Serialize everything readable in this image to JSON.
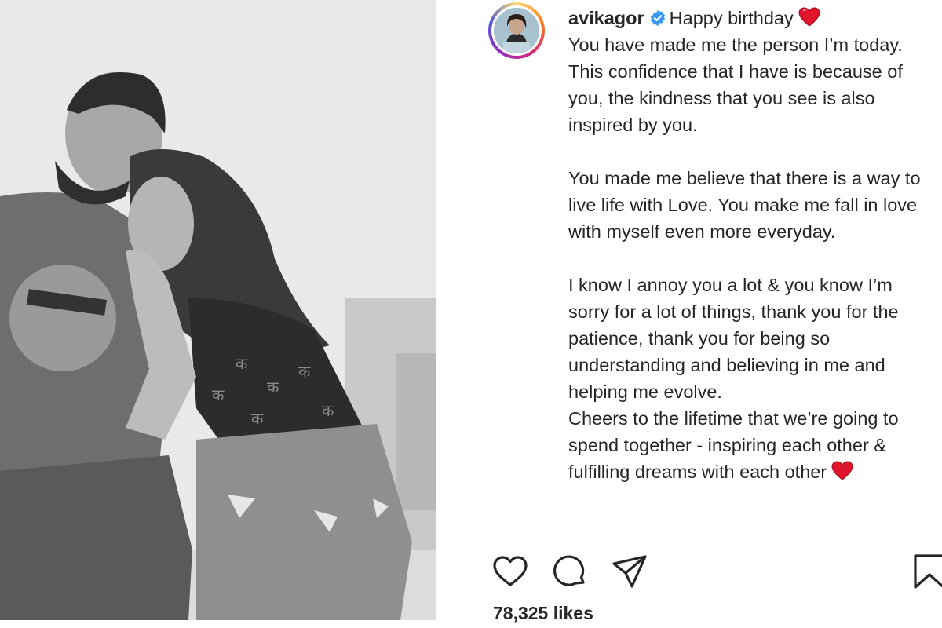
{
  "post": {
    "username": "avikagor",
    "verified": true,
    "caption_intro": "Happy birthday",
    "caption_paragraphs": [
      "You have made me the person I’m today. This confidence that I have is because of you, the kindness that you see is also inspired by you.",
      "You made me believe that there is a way to live life with Love. You make me fall in love with myself even more everyday.",
      "I know I annoy you a lot & you know I’m sorry for a lot of things, thank you for the patience, thank you for being so understanding and believing in me and helping me evolve.",
      "Cheers to the lifetime that we’re going to spend together - inspiring each other & fulfilling dreams with each other"
    ],
    "likes_text": "78,325 likes"
  },
  "icons": {
    "like": "heart-outline-icon",
    "comment": "comment-bubble-icon",
    "share": "paper-plane-icon",
    "save": "bookmark-icon",
    "verified": "verified-badge-icon",
    "emoji": "red-heart-emoji"
  },
  "colors": {
    "verified_blue": "#3897f0",
    "heart_red": "#e0142b",
    "text": "#262626",
    "divider": "#dbdbdb"
  }
}
